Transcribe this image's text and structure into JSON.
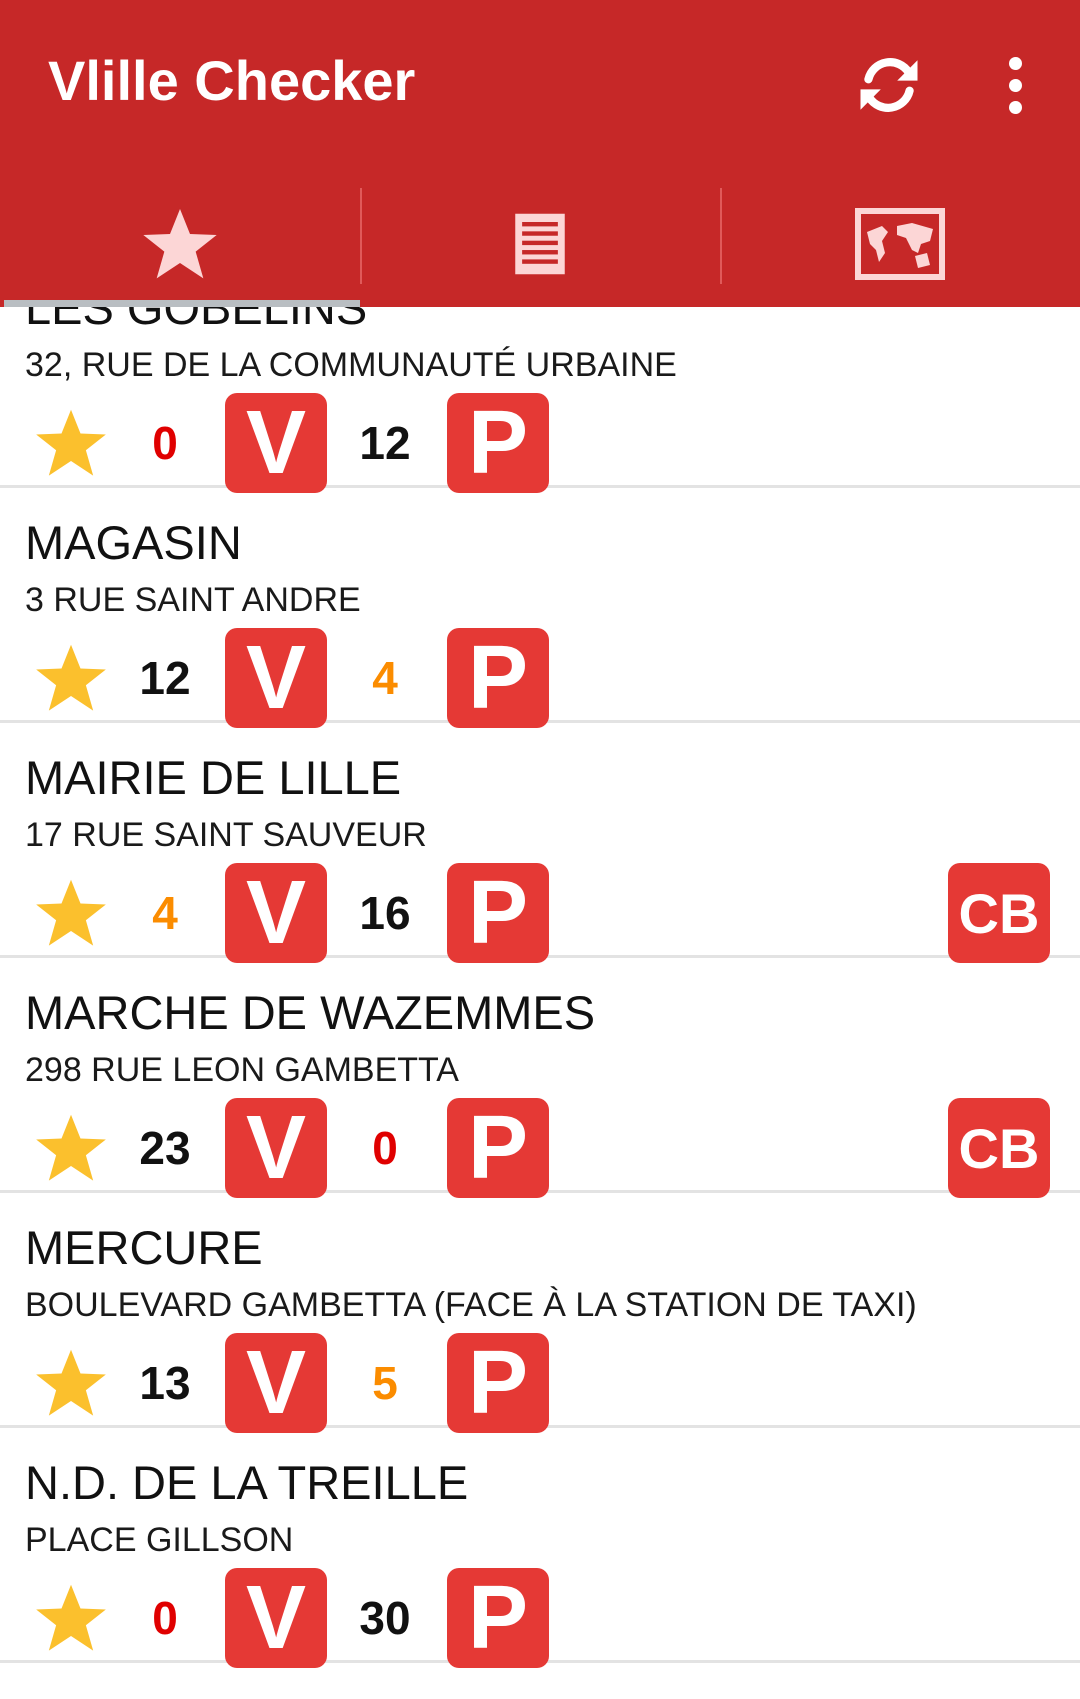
{
  "app": {
    "title": "Vlille Checker",
    "accent": "#c62828",
    "badge_color": "#e53935",
    "star_color": "#fbc02d",
    "zero_color": "#e00000",
    "low_color": "#fb8c00",
    "normal_color": "#111111"
  },
  "toolbar": {
    "refresh_icon": "refresh-icon",
    "overflow_icon": "more-vert-icon"
  },
  "tabs": [
    {
      "icon": "star-icon",
      "selected": true
    },
    {
      "icon": "list-icon",
      "selected": false
    },
    {
      "icon": "map-icon",
      "selected": false
    }
  ],
  "badges": {
    "bikes": "V",
    "parking": "P",
    "card": "CB"
  },
  "stations": [
    {
      "name": "LES GOBELINS",
      "address": "32, RUE DE LA COMMUNAUTÉ URBAINE",
      "bikes": "0",
      "bikes_status": "zero",
      "docks": "12",
      "docks_status": "normal",
      "cb": false
    },
    {
      "name": "MAGASIN",
      "address": "3 RUE SAINT ANDRE",
      "bikes": "12",
      "bikes_status": "normal",
      "docks": "4",
      "docks_status": "low",
      "cb": false
    },
    {
      "name": "MAIRIE DE LILLE",
      "address": "17 RUE SAINT SAUVEUR",
      "bikes": "4",
      "bikes_status": "low",
      "docks": "16",
      "docks_status": "normal",
      "cb": true
    },
    {
      "name": "MARCHE DE WAZEMMES",
      "address": "298 RUE LEON GAMBETTA",
      "bikes": "23",
      "bikes_status": "normal",
      "docks": "0",
      "docks_status": "zero",
      "cb": true
    },
    {
      "name": "MERCURE",
      "address": "BOULEVARD GAMBETTA (FACE À LA STATION DE TAXI)",
      "bikes": "13",
      "bikes_status": "normal",
      "docks": "5",
      "docks_status": "low",
      "cb": false
    },
    {
      "name": "N.D. DE LA TREILLE",
      "address": "PLACE GILLSON",
      "bikes": "0",
      "bikes_status": "zero",
      "docks": "30",
      "docks_status": "normal",
      "cb": false
    }
  ]
}
